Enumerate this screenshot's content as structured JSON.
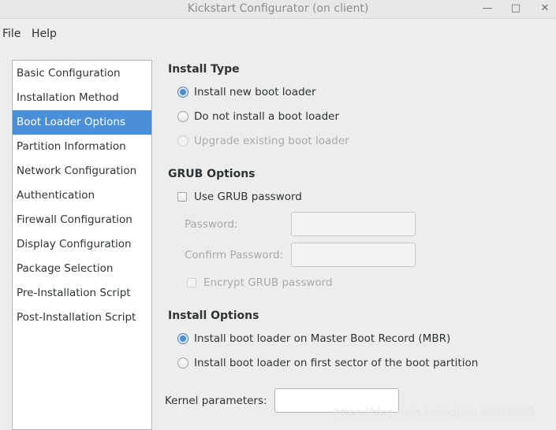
{
  "window": {
    "title": "Kickstart Configurator (on client)",
    "minimize_glyph": "—",
    "maximize_glyph": "□",
    "close_glyph": "✕"
  },
  "menubar": {
    "file": "File",
    "help": "Help"
  },
  "sidebar": {
    "items": [
      {
        "label": "Basic Configuration",
        "selected": false
      },
      {
        "label": "Installation Method",
        "selected": false
      },
      {
        "label": "Boot Loader Options",
        "selected": true
      },
      {
        "label": "Partition Information",
        "selected": false
      },
      {
        "label": "Network Configuration",
        "selected": false
      },
      {
        "label": "Authentication",
        "selected": false
      },
      {
        "label": "Firewall Configuration",
        "selected": false
      },
      {
        "label": "Display Configuration",
        "selected": false
      },
      {
        "label": "Package Selection",
        "selected": false
      },
      {
        "label": "Pre-Installation Script",
        "selected": false
      },
      {
        "label": "Post-Installation Script",
        "selected": false
      }
    ]
  },
  "install_type": {
    "title": "Install Type",
    "options": [
      {
        "label": "Install new boot loader",
        "checked": true,
        "enabled": true
      },
      {
        "label": "Do not install a boot loader",
        "checked": false,
        "enabled": true
      },
      {
        "label": "Upgrade existing boot loader",
        "checked": false,
        "enabled": false
      }
    ]
  },
  "grub": {
    "title": "GRUB Options",
    "use_password_label": "Use GRUB password",
    "password_label": "Password:",
    "password_value": "",
    "confirm_label": "Confirm Password:",
    "confirm_value": "",
    "encrypt_label": "Encrypt GRUB password"
  },
  "install_options": {
    "title": "Install Options",
    "options": [
      {
        "label": "Install boot loader on Master Boot Record (MBR)",
        "checked": true
      },
      {
        "label": "Install boot loader on first sector of the boot partition",
        "checked": false
      }
    ]
  },
  "kernel": {
    "label": "Kernel parameters:",
    "value": ""
  },
  "watermark": "https://blog.csdn.net/weixin_44416500",
  "colors": {
    "selection": "#4a90d9",
    "window_bg": "#ededed"
  }
}
